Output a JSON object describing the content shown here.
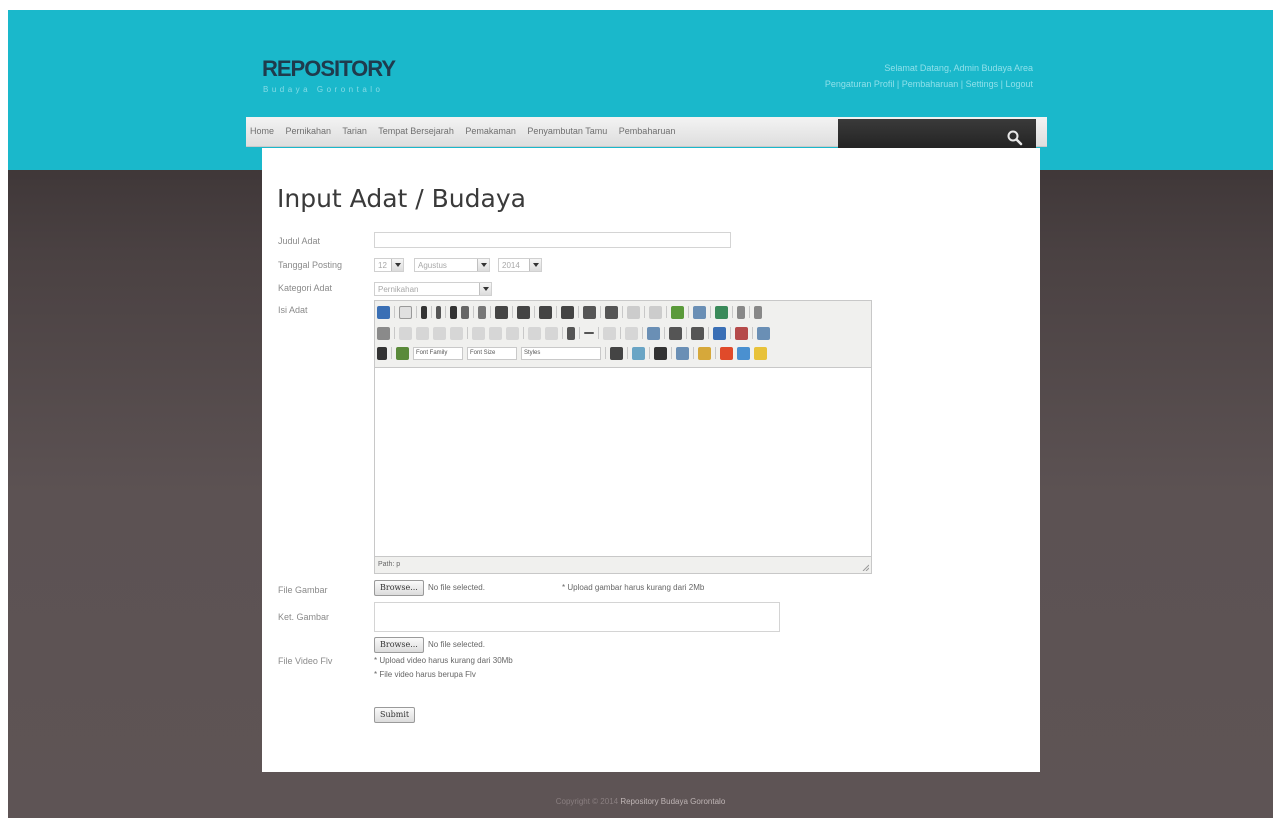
{
  "header": {
    "logo": "REPOSITORY",
    "logo_sub": "Budaya Gorontalo",
    "welcome_line": "Selamat Datang, Admin Budaya Area",
    "links": [
      "Pengaturan Profil",
      "Pembaharuan",
      "Settings",
      "Logout"
    ]
  },
  "nav": {
    "items": [
      "Home",
      "Pernikahan",
      "Tarian",
      "Tempat Bersejarah",
      "Pemakaman",
      "Penyambutan Tamu",
      "Pembaharuan"
    ],
    "search_placeholder": ""
  },
  "form": {
    "title": "Input Adat / Budaya",
    "judul_label": "Judul Adat",
    "tanggal_label": "Tanggal Posting",
    "tanggal_day": "12",
    "tanggal_month": "Agustus",
    "tanggal_year": "2014",
    "kategori_label": "Kategori Adat",
    "kategori_value": "Pernikahan",
    "isi_label": "Isi Adat",
    "editor": {
      "font_family": "Font Family",
      "font_size": "Font Size",
      "styles": "Styles",
      "path_label": "Path: p"
    },
    "gambar_label": "File Gambar",
    "browse_label": "Browse...",
    "no_file": "No file selected.",
    "gambar_note": "* Upload gambar harus kurang dari 2Mb",
    "ket_label": "Ket. Gambar",
    "video_label": "File Video Flv",
    "video_note1": "* Upload video harus kurang dari 30Mb",
    "video_note2": "* File video harus berupa Flv",
    "submit_label": "Submit"
  },
  "footer": {
    "prefix": "Copyright © 2014",
    "brand": "Repository Budaya Gorontalo"
  },
  "colors": {
    "header_band": "#1ab8cb",
    "logo": "#1f3b4d",
    "background": "#4a4142"
  }
}
